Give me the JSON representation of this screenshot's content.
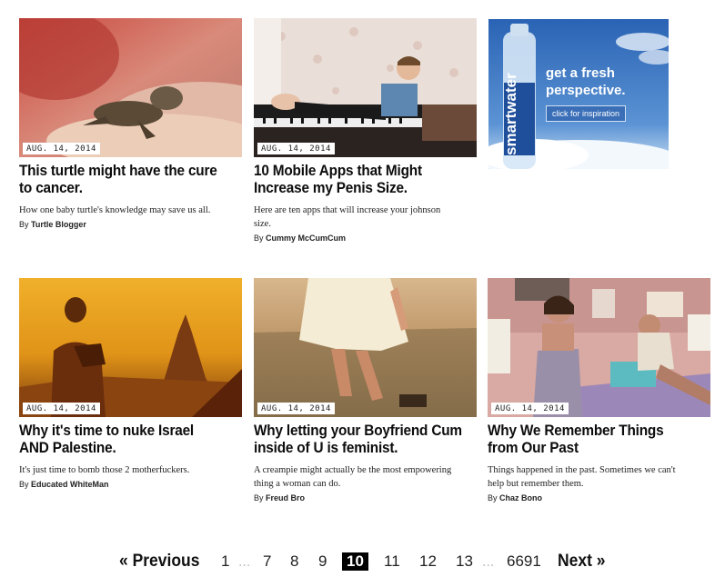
{
  "articles": [
    {
      "date": "AUG. 14, 2014",
      "title_line1": "This turtle might have the cure",
      "title_line2": "to cancer.",
      "desc_line1": "How one baby turtle's knowledge may save us all.",
      "desc_line2": "",
      "by_prefix": "By",
      "author": "Turtle Blogger"
    },
    {
      "date": "AUG. 14, 2014",
      "title_line1": "10 Mobile Apps that Might",
      "title_line2": "Increase my Penis Size.",
      "desc_line1": "Here are ten apps that will increase your johnson",
      "desc_line2": "size.",
      "by_prefix": "By",
      "author": "Cummy McCumCum"
    },
    {
      "date": "AUG. 14, 2014",
      "title_line1": "Why it's time to nuke Israel",
      "title_line2": "AND Palestine.",
      "desc_line1": "It's just time to bomb those 2 motherfuckers.",
      "desc_line2": "",
      "by_prefix": "By",
      "author": "Educated WhiteMan"
    },
    {
      "date": "AUG. 14, 2014",
      "title_line1": "Why letting your Boyfriend Cum",
      "title_line2": "inside of U is feminist.",
      "desc_line1": "A creampie might actually be the most empowering",
      "desc_line2": "thing a woman can do.",
      "by_prefix": "By",
      "author": "Freud Bro"
    },
    {
      "date": "AUG. 14, 2014",
      "title_line1": "Why We Remember Things",
      "title_line2": "from Our Past",
      "desc_line1": "Things happened in the past. Sometimes we can't",
      "desc_line2": "help but remember them.",
      "by_prefix": "By",
      "author": "Chaz Bono"
    }
  ],
  "ad": {
    "brand": "smartwater",
    "headline_line1": "get a fresh",
    "headline_line2": "perspective.",
    "cta": "click for inspiration"
  },
  "pagination": {
    "prev": "« Previous",
    "next": "Next »",
    "ellipsis": "...",
    "pages": [
      "1",
      "7",
      "8",
      "9",
      "10",
      "11",
      "12",
      "13",
      "6691"
    ],
    "current": "10"
  },
  "colors": {
    "current_page_bg": "#000000",
    "ad_sky": "#2a63b4"
  }
}
